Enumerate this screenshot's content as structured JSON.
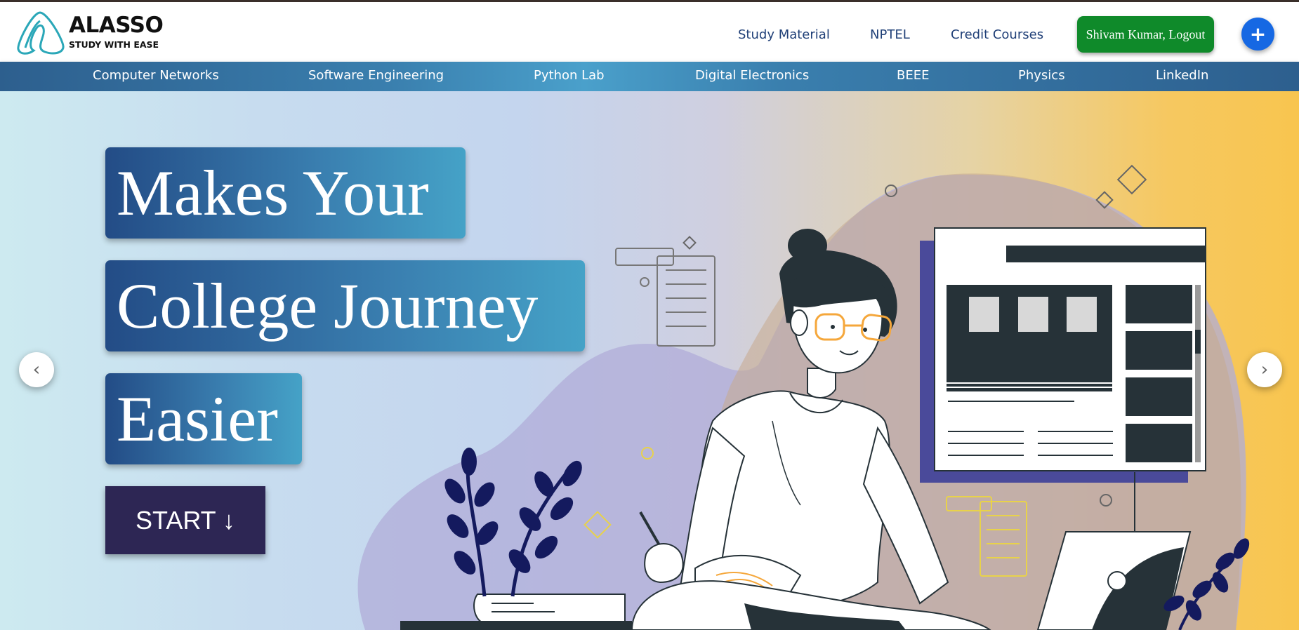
{
  "brand": {
    "name": "ALASSO",
    "tagline": "STUDY WITH EASE"
  },
  "header": {
    "nav": [
      {
        "label": "Study Material"
      },
      {
        "label": "NPTEL"
      },
      {
        "label": "Credit Courses"
      }
    ],
    "user_button": "Shivam Kumar, Logout",
    "plus_button": "+"
  },
  "subjects": [
    {
      "label": "Computer Networks"
    },
    {
      "label": "Software Engineering"
    },
    {
      "label": "Python Lab"
    },
    {
      "label": "Digital Electronics"
    },
    {
      "label": "BEEE"
    },
    {
      "label": "Physics"
    },
    {
      "label": "LinkedIn"
    }
  ],
  "hero": {
    "line1": "Makes Your",
    "line2": "College Journey",
    "line3": "Easier",
    "start_button": "START ↓",
    "prev_arrow": "‹",
    "next_arrow": "›"
  },
  "colors": {
    "accent_green": "#0f8a2a",
    "accent_blue": "#1668e3",
    "nav_text": "#1f3f77",
    "start_button": "#2d2654",
    "illustration_dark": "#263238",
    "illustration_navy": "#141a5e",
    "illustration_purple": "#4a4a9a"
  }
}
